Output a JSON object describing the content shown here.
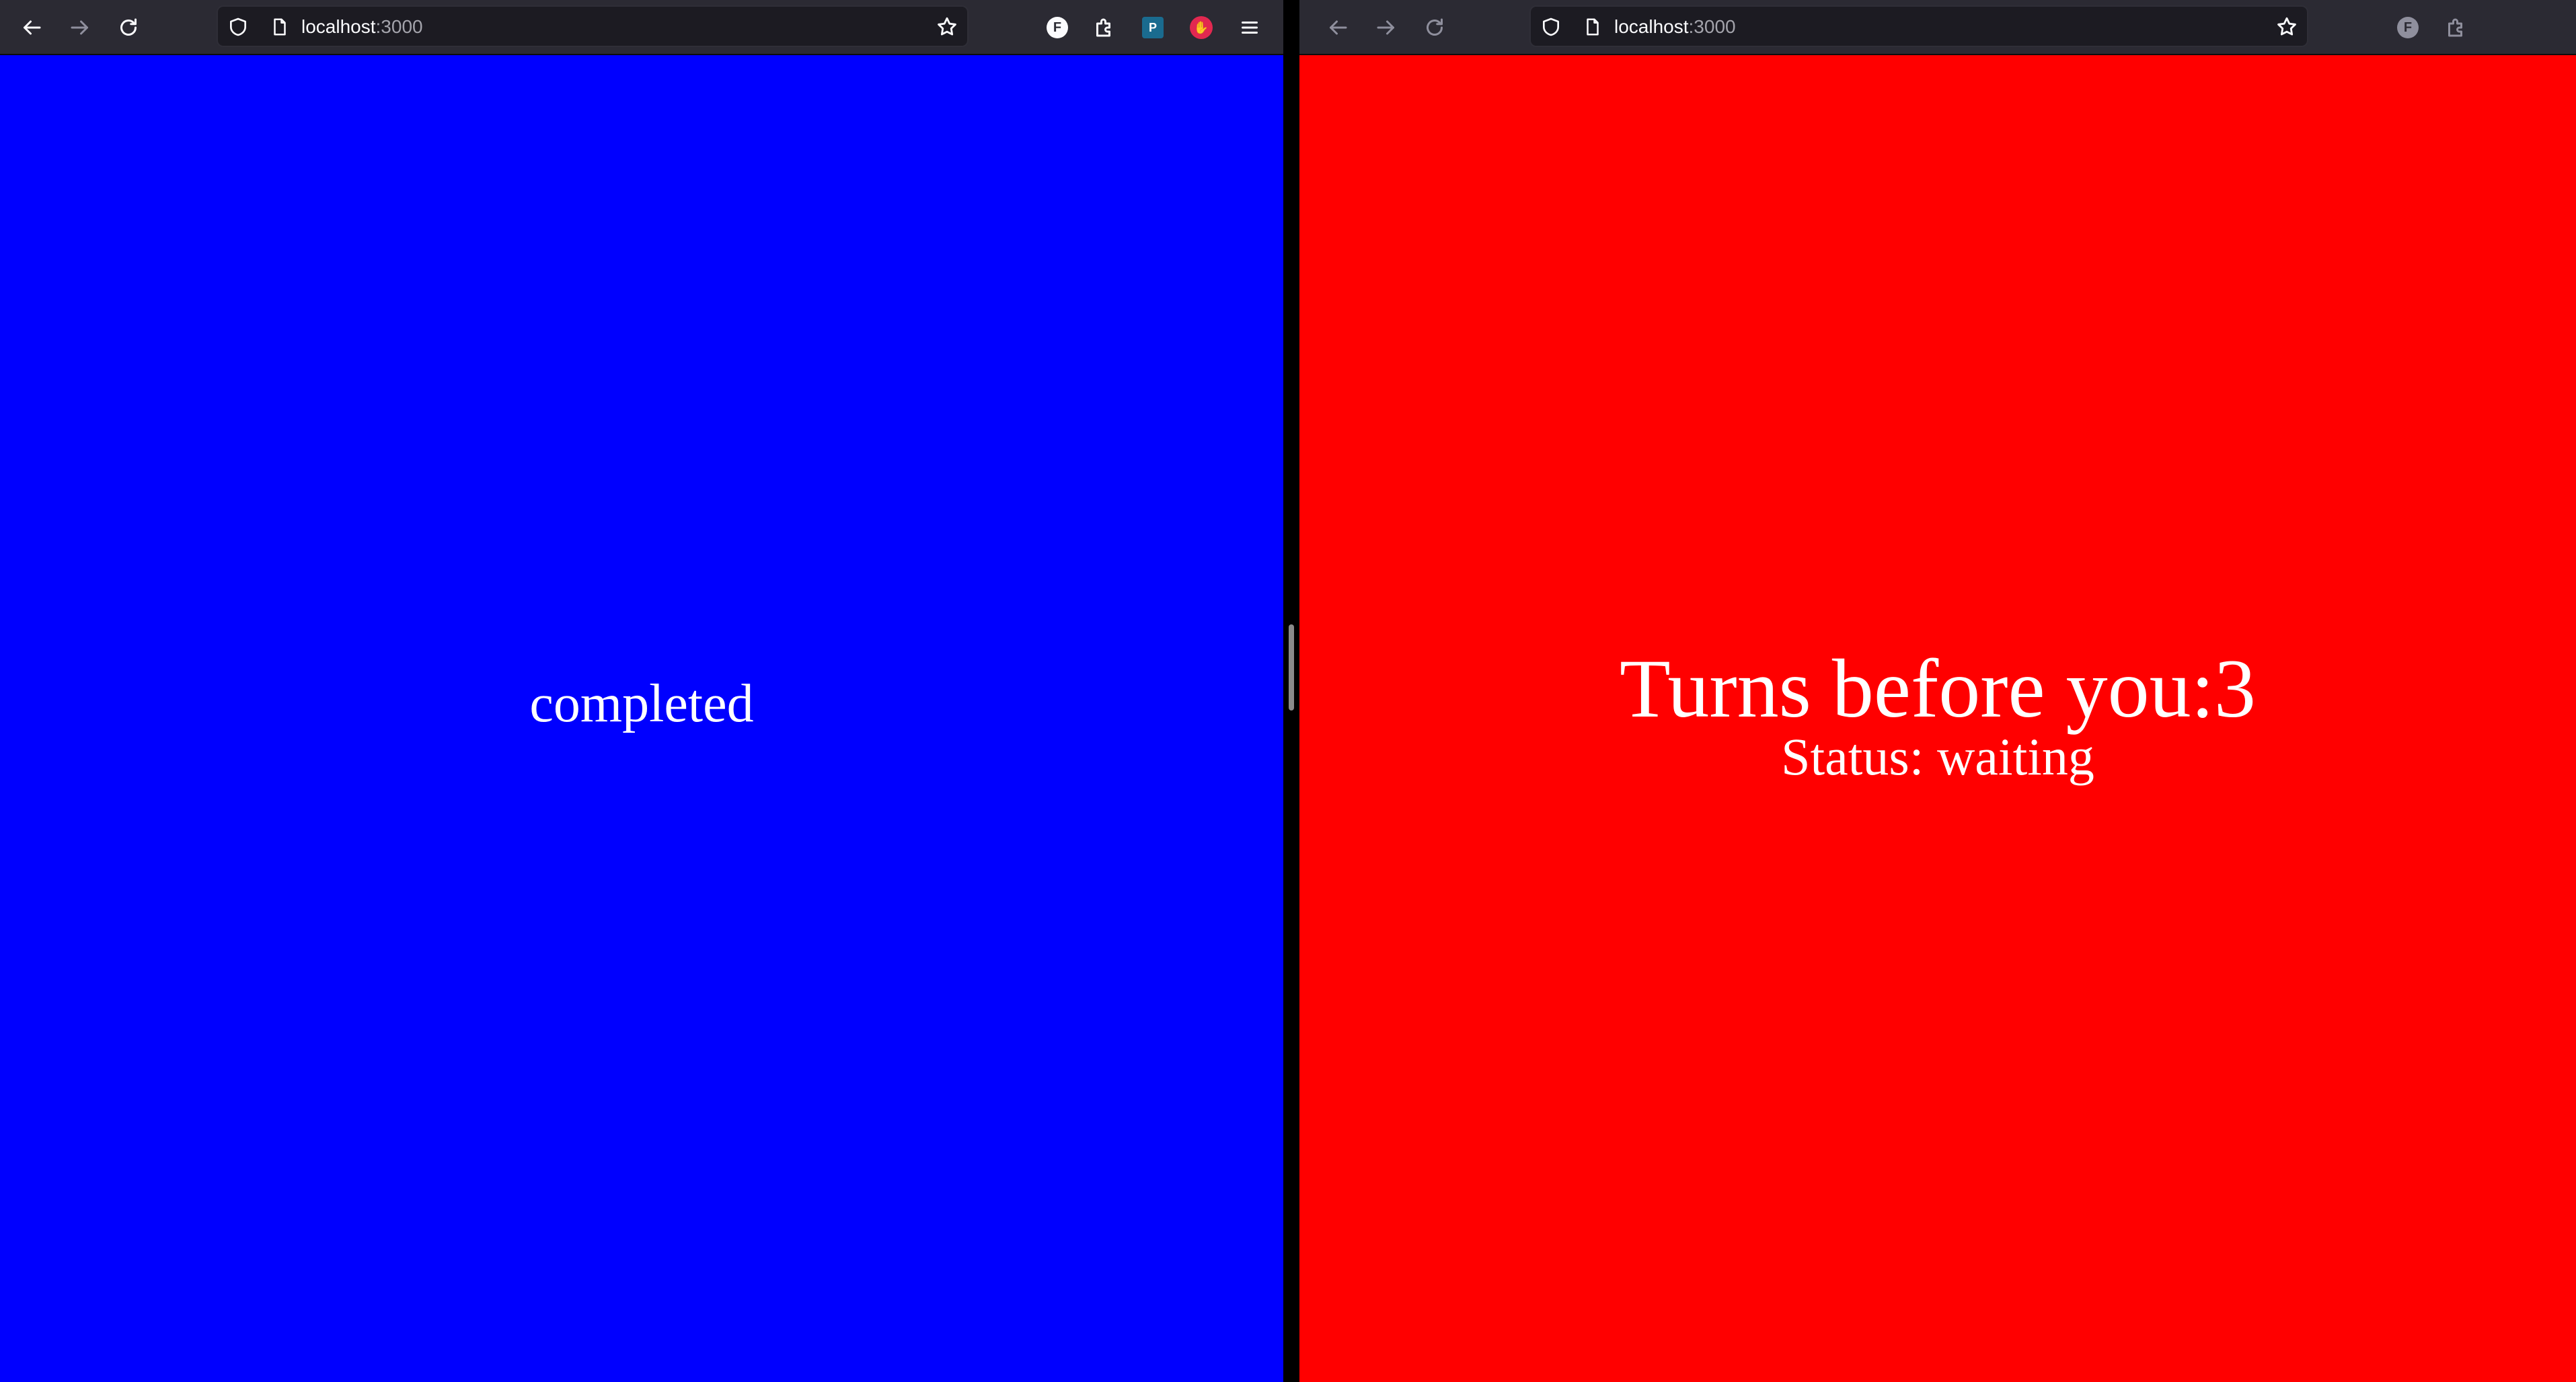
{
  "left_window": {
    "url_host": "localhost",
    "url_port": ":3000",
    "background_color": "#0000ff",
    "status_text": "completed",
    "extensions": {
      "f_badge": "F",
      "teal_badge": "P",
      "red_badge": "✋"
    },
    "icons": [
      "back-arrow-icon",
      "forward-arrow-icon",
      "reload-icon",
      "shield-icon",
      "page-icon",
      "star-icon",
      "extensions-icon",
      "hamburger-menu-icon"
    ]
  },
  "right_window": {
    "url_host": "localhost",
    "url_port": ":3000",
    "background_color": "#ff0000",
    "turns_text": "Turns before you:3",
    "status_text": "Status: waiting",
    "extensions": {
      "f_badge": "F"
    },
    "icons": [
      "back-arrow-icon",
      "forward-arrow-icon",
      "reload-icon",
      "shield-icon",
      "page-icon",
      "star-icon",
      "extensions-icon"
    ]
  }
}
